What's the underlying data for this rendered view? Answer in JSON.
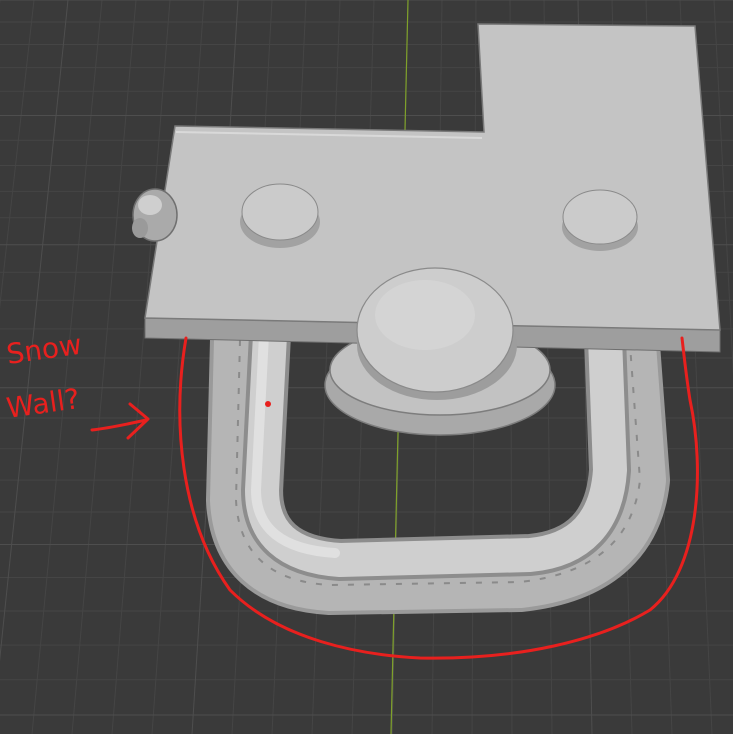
{
  "viewport": {
    "background": "#3a3a3a",
    "grid_minor_color": "#454545",
    "grid_major_color": "#4e4e4e",
    "y_axis_color": "#7fa12a"
  },
  "model": {
    "surface_color": "#bdbdbd",
    "surface_light": "#d2d2d2",
    "surface_shadow": "#8c8c8c",
    "edge_color": "#6e6e6e"
  },
  "annotation": {
    "text_line1": "Snow",
    "text_line2": "Wall?",
    "color": "#e8201e"
  }
}
